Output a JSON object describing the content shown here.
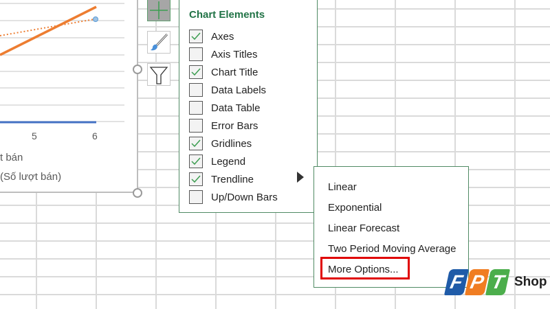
{
  "chart": {
    "x_ticks": [
      "5",
      "6"
    ],
    "legend": [
      "t bán",
      "(Số lượt bán)"
    ],
    "colors": {
      "series1": "#4472c4",
      "series2": "#ed7d31"
    }
  },
  "side_buttons": [
    "chart-elements",
    "chart-styles",
    "chart-filters"
  ],
  "panel": {
    "title": "Chart Elements",
    "items": [
      {
        "label": "Axes",
        "checked": true
      },
      {
        "label": "Axis Titles",
        "checked": false
      },
      {
        "label": "Chart Title",
        "checked": true
      },
      {
        "label": "Data Labels",
        "checked": false
      },
      {
        "label": "Data Table",
        "checked": false
      },
      {
        "label": "Error Bars",
        "checked": false
      },
      {
        "label": "Gridlines",
        "checked": true
      },
      {
        "label": "Legend",
        "checked": true
      },
      {
        "label": "Trendline",
        "checked": true
      },
      {
        "label": "Up/Down Bars",
        "checked": false
      }
    ]
  },
  "submenu": {
    "items": [
      "Linear",
      "Exponential",
      "Linear Forecast",
      "Two Period Moving Average",
      "More Options..."
    ]
  },
  "logo": {
    "letters": [
      "F",
      "P",
      "T"
    ],
    "text": "Shop"
  },
  "accent": "#217346",
  "highlight": "#e00000"
}
